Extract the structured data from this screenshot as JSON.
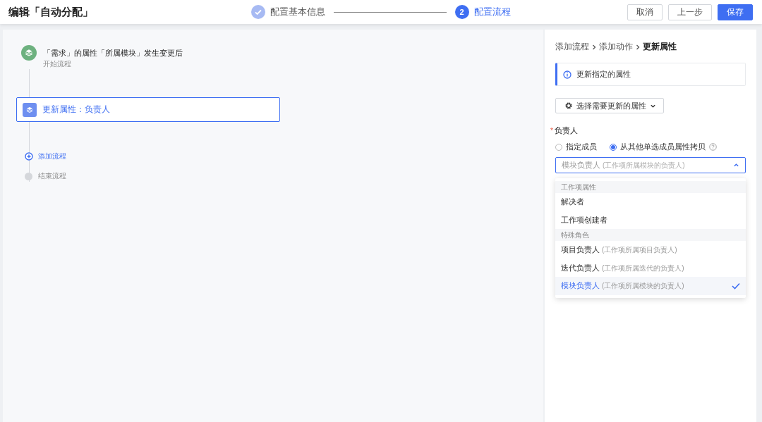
{
  "title": "编辑「自动分配」",
  "steps": [
    {
      "label": "配置基本信息",
      "completed": true,
      "selected": false
    },
    {
      "number": "2",
      "label": "配置流程",
      "completed": false,
      "selected": true
    }
  ],
  "buttons": [
    {
      "label": "取消",
      "kind": "default"
    },
    {
      "label": "上一步",
      "kind": "default"
    },
    {
      "label": "保存",
      "kind": "primary"
    }
  ],
  "flow": {
    "trigger": {
      "title": "「需求」的属性「所属模块」发生变更后",
      "subtitle": "开始流程"
    },
    "actions": [
      {
        "label": "更新属性：负责人",
        "selected": true
      }
    ],
    "add_label": "添加流程",
    "end_label": "结束流程"
  },
  "panel": {
    "breadcrumb": [
      "添加流程",
      "添加动作",
      "更新属性"
    ],
    "info": "更新指定的属性",
    "attribute_button": "选择需要更新的属性",
    "field": {
      "label": "负责人",
      "required_mark": "*",
      "options": [
        {
          "label": "指定成员",
          "selected": false
        },
        {
          "label": "从其他单选成员属性拷贝",
          "selected": true
        }
      ],
      "select_value": "模块负责人",
      "select_hint": "(工作项所属模块的负责人)",
      "expanded": true
    },
    "dropdown": [
      {
        "group": "工作项属性",
        "items": [
          {
            "label": "解决者",
            "selected": false
          },
          {
            "label": "工作项创建者",
            "selected": false
          }
        ]
      },
      {
        "group": "特殊角色",
        "items": [
          {
            "label": "项目负责人",
            "hint": "(工作项所属项目负责人)",
            "selected": false
          },
          {
            "label": "迭代负责人",
            "hint": "(工作项所属迭代的负责人)",
            "selected": false
          },
          {
            "label": "模块负责人",
            "hint": "(工作项所属模块的负责人)",
            "selected": true
          }
        ]
      }
    ]
  }
}
